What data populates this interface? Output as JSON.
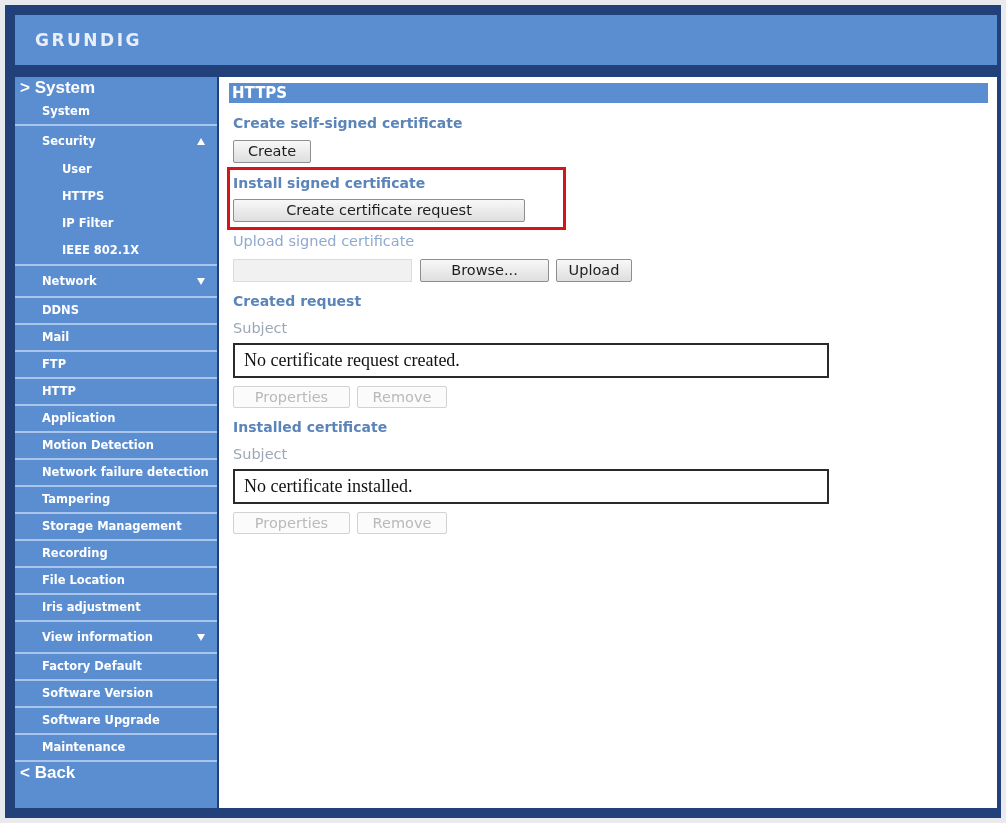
{
  "header": {
    "logo": "GRUNDIG"
  },
  "sidebar": {
    "heading": "> System",
    "items": [
      {
        "kind": "link",
        "label": "System"
      },
      {
        "kind": "group",
        "label": "Security",
        "expanded": true,
        "children": [
          {
            "label": "User"
          },
          {
            "label": "HTTPS"
          },
          {
            "label": "IP Filter"
          },
          {
            "label": "IEEE 802.1X"
          }
        ]
      },
      {
        "kind": "group",
        "label": "Network",
        "expanded": false
      },
      {
        "kind": "link",
        "label": "DDNS"
      },
      {
        "kind": "link",
        "label": "Mail"
      },
      {
        "kind": "link",
        "label": "FTP"
      },
      {
        "kind": "link",
        "label": "HTTP"
      },
      {
        "kind": "link",
        "label": "Application"
      },
      {
        "kind": "link",
        "label": "Motion Detection"
      },
      {
        "kind": "link",
        "label": "Network failure detection"
      },
      {
        "kind": "link",
        "label": "Tampering"
      },
      {
        "kind": "link",
        "label": "Storage Management"
      },
      {
        "kind": "link",
        "label": "Recording"
      },
      {
        "kind": "link",
        "label": "File Location"
      },
      {
        "kind": "link",
        "label": "Iris adjustment"
      },
      {
        "kind": "group",
        "label": "View information",
        "expanded": false
      },
      {
        "kind": "link",
        "label": "Factory Default"
      },
      {
        "kind": "link",
        "label": "Software Version"
      },
      {
        "kind": "link",
        "label": "Software Upgrade"
      },
      {
        "kind": "link",
        "label": "Maintenance"
      }
    ],
    "back": "< Back"
  },
  "panel": {
    "title": "HTTPS",
    "sections": [
      {
        "kind": "create",
        "heading": "Create self-signed certificate",
        "highlighted": false,
        "buttons": [
          {
            "label": "Create",
            "disabled": false
          }
        ]
      },
      {
        "kind": "request",
        "heading": "Install signed certificate",
        "highlighted": true,
        "buttons": [
          {
            "label": "Create certificate request",
            "disabled": false
          }
        ]
      },
      {
        "kind": "upload",
        "heading": "Upload signed certificate",
        "highlighted": false,
        "file_field": {
          "disabled": true
        },
        "buttons": [
          {
            "label": "Browse...",
            "disabled": false
          },
          {
            "label": "Upload",
            "disabled": false
          }
        ]
      },
      {
        "kind": "certificate",
        "heading": "Created request",
        "highlighted": false,
        "subject_label": "Subject",
        "subject": "No certificate request created.",
        "buttons": [
          {
            "label": "Properties",
            "disabled": true
          },
          {
            "label": "Remove",
            "disabled": true
          }
        ]
      },
      {
        "kind": "certificate",
        "heading": "Installed certificate",
        "highlighted": false,
        "subject_label": "Subject",
        "subject": "No certificate installed.",
        "buttons": [
          {
            "label": "Properties",
            "disabled": true
          },
          {
            "label": "Remove",
            "disabled": true
          }
        ]
      }
    ]
  }
}
